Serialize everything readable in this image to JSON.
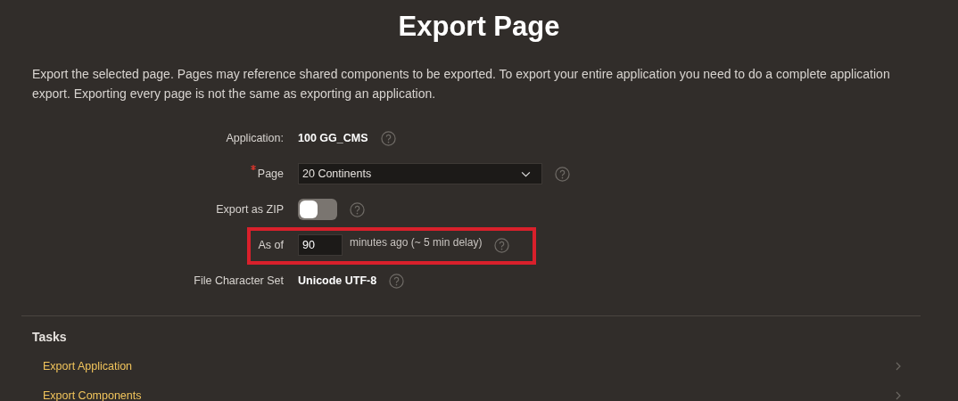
{
  "title": "Export Page",
  "description": "Export the selected page. Pages may reference shared components to be exported. To export your entire application you need to do a complete application export. Exporting every page is not the same as exporting an application.",
  "fields": [
    {
      "kind": "display",
      "label": "Application:",
      "value": "100 GG_CMS",
      "required": false,
      "highlighted": false
    },
    {
      "kind": "select",
      "label": "Page",
      "value": "20 Continents",
      "required": true,
      "highlighted": false
    },
    {
      "kind": "switch",
      "label": "Export as ZIP",
      "on": false,
      "required": false,
      "highlighted": false
    },
    {
      "kind": "number",
      "label": "As of",
      "value": "90",
      "suffix": "minutes ago (~ 5 min delay)",
      "required": false,
      "highlighted": true
    },
    {
      "kind": "display",
      "label": "File Character Set",
      "value": "Unicode UTF-8",
      "required": false,
      "highlighted": false
    }
  ],
  "tasks": {
    "heading": "Tasks",
    "items": [
      {
        "label": "Export Application"
      },
      {
        "label": "Export Components"
      }
    ]
  }
}
